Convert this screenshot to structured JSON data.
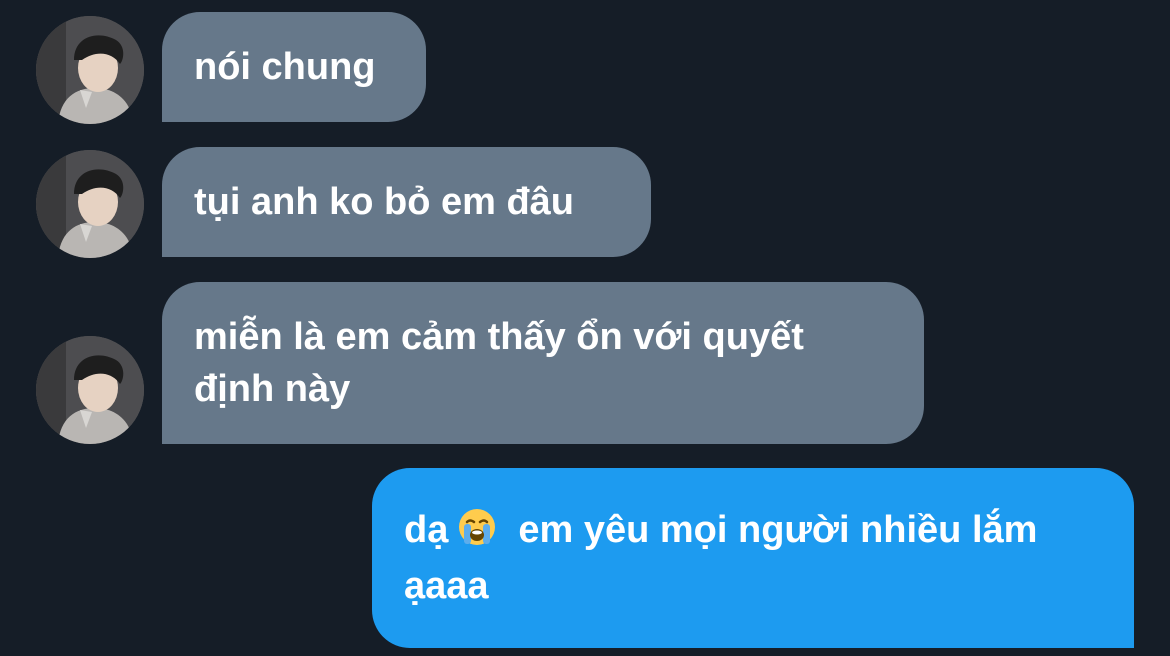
{
  "messages": [
    {
      "sender": "them",
      "text": "nói chung"
    },
    {
      "sender": "them",
      "text": "tụi anh ko bỏ em đâu"
    },
    {
      "sender": "them",
      "text": "miễn là em cảm thấy ổn với quyết định này"
    },
    {
      "sender": "me",
      "text_before_emoji": "dạ",
      "emoji": "loudly-crying-face-icon",
      "text_after_emoji": "em yêu mọi người nhiều lắm ạaaa"
    }
  ],
  "colors": {
    "background": "#151d27",
    "incoming_bubble": "#66788a",
    "outgoing_bubble": "#1d9bf0",
    "text": "#ffffff"
  }
}
